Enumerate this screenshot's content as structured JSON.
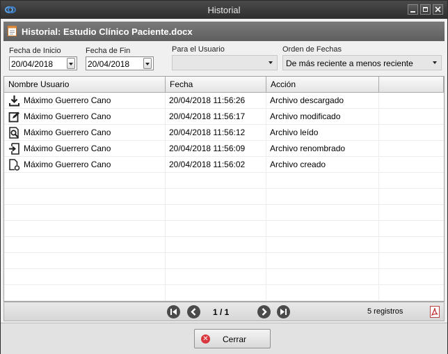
{
  "window": {
    "title": "Historial"
  },
  "header": {
    "title": "Historial: Estudio Clínico Paciente.docx"
  },
  "filters": {
    "start_label": "Fecha de Inicio",
    "start_value": "20/04/2018",
    "end_label": "Fecha de Fin",
    "end_value": "20/04/2018",
    "user_label": "Para el Usuario",
    "user_value": "",
    "order_label": "Orden de Fechas",
    "order_value": "De más reciente a menos reciente"
  },
  "table": {
    "columns": [
      "Nombre Usuario",
      "Fecha",
      "Acción"
    ],
    "rows": [
      {
        "icon": "download-icon",
        "user": "Máximo Guerrero Cano",
        "date": "20/04/2018 11:56:26",
        "action": "Archivo descargado"
      },
      {
        "icon": "edit-icon",
        "user": "Máximo Guerrero Cano",
        "date": "20/04/2018 11:56:17",
        "action": "Archivo modificado"
      },
      {
        "icon": "read-icon",
        "user": "Máximo Guerrero Cano",
        "date": "20/04/2018 11:56:12",
        "action": "Archivo leído"
      },
      {
        "icon": "rename-icon",
        "user": "Máximo Guerrero Cano",
        "date": "20/04/2018 11:56:09",
        "action": "Archivo renombrado"
      },
      {
        "icon": "file-created-icon",
        "user": "Máximo Guerrero Cano",
        "date": "20/04/2018 11:56:02",
        "action": "Archivo creado"
      }
    ]
  },
  "pager": {
    "page": "1 / 1",
    "records": "5 registros"
  },
  "footer": {
    "close_label": "Cerrar"
  }
}
